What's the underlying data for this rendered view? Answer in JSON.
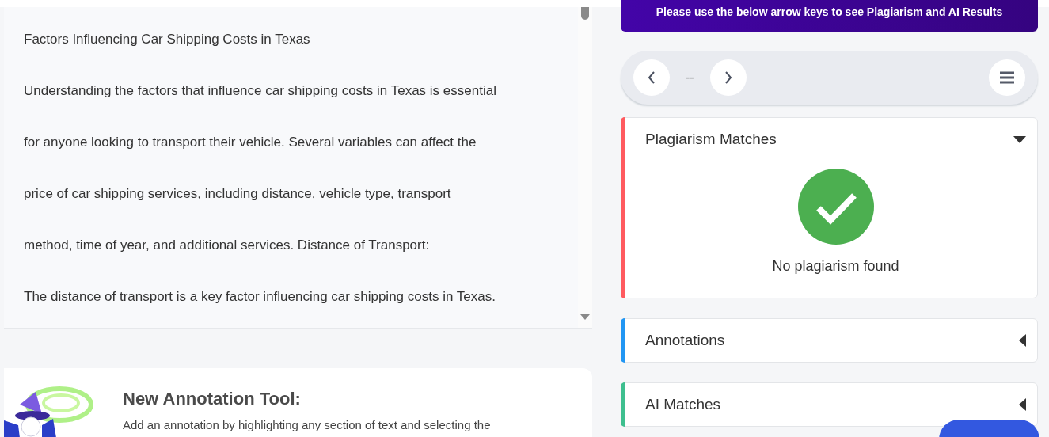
{
  "document": {
    "lines": [
      "Factors Influencing Car Shipping Costs in Texas",
      "Understanding the factors that influence car shipping costs in Texas is essential",
      "for anyone looking to transport their vehicle. Several variables can affect the",
      "price of car shipping services, including distance, vehicle type, transport",
      "method, time of year, and additional services. Distance of Transport:",
      "The distance of transport is a key factor influencing car shipping costs in Texas."
    ]
  },
  "tip": {
    "title": "New Annotation Tool:",
    "text": "Add an annotation by highlighting any section of text and selecting the"
  },
  "banner": {
    "text": "Please use the below arrow keys to see Plagiarism and AI Results"
  },
  "navigator": {
    "counter": "--"
  },
  "sections": [
    {
      "title": "Plagiarism Matches",
      "color": "#ff5a5f",
      "expanded": true,
      "message": "No plagiarism found"
    },
    {
      "title": "Annotations",
      "color": "#2196f3",
      "expanded": false
    },
    {
      "title": "AI Matches",
      "color": "#3ebf8f",
      "expanded": false
    }
  ]
}
